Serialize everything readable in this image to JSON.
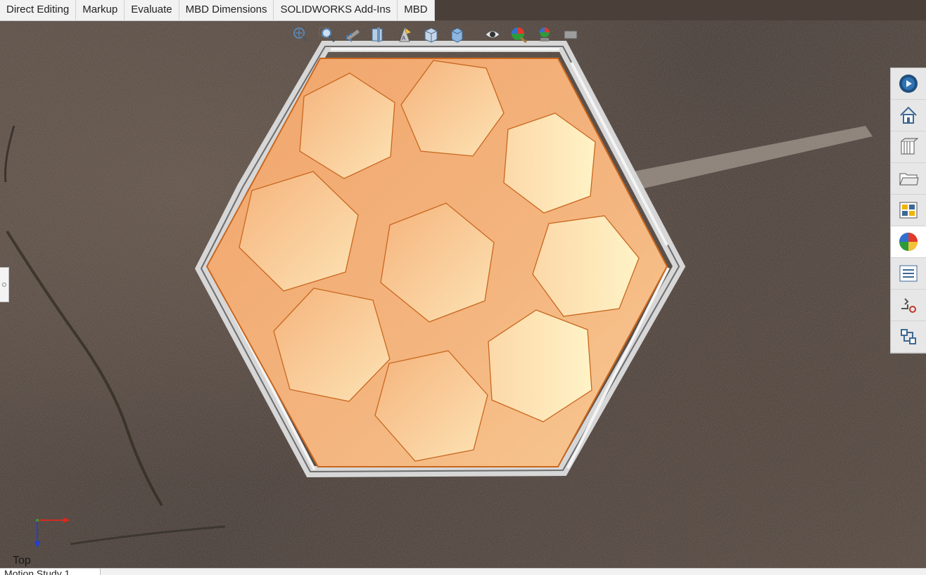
{
  "command_manager": {
    "tabs": [
      {
        "label": "Direct Editing"
      },
      {
        "label": "Markup"
      },
      {
        "label": "Evaluate"
      },
      {
        "label": "MBD Dimensions"
      },
      {
        "label": "SOLIDWORKS Add-Ins"
      },
      {
        "label": "MBD"
      }
    ]
  },
  "heads_up_toolbar": {
    "icons": [
      "zoom-to-fit-icon",
      "zoom-to-area-icon",
      "previous-view-icon",
      "section-view-icon",
      "dynamic-annotation-icon",
      "view-orientation-icon",
      "display-style-icon",
      "hide-show-items-icon",
      "edit-appearance-icon",
      "apply-scene-icon",
      "view-settings-icon"
    ]
  },
  "task_pane": {
    "items": [
      {
        "icon": "solidworks-resources-icon"
      },
      {
        "icon": "home-icon"
      },
      {
        "icon": "design-library-icon"
      },
      {
        "icon": "file-explorer-icon"
      },
      {
        "icon": "view-palette-icon"
      },
      {
        "icon": "appearances-scenes-icon",
        "active": true
      },
      {
        "icon": "custom-properties-icon"
      },
      {
        "icon": "solidworks-forum-icon"
      },
      {
        "icon": "3d-interconnect-icon"
      }
    ]
  },
  "viewport": {
    "view_name": "Top",
    "model_colors": {
      "base_face": "#f2ad74",
      "pocket_face": "#fbd2a2",
      "edge": "#c8671f",
      "frame": "#e6e6e6"
    }
  },
  "bottom_tabs": [
    {
      "label": "Motion Study 1"
    }
  ]
}
